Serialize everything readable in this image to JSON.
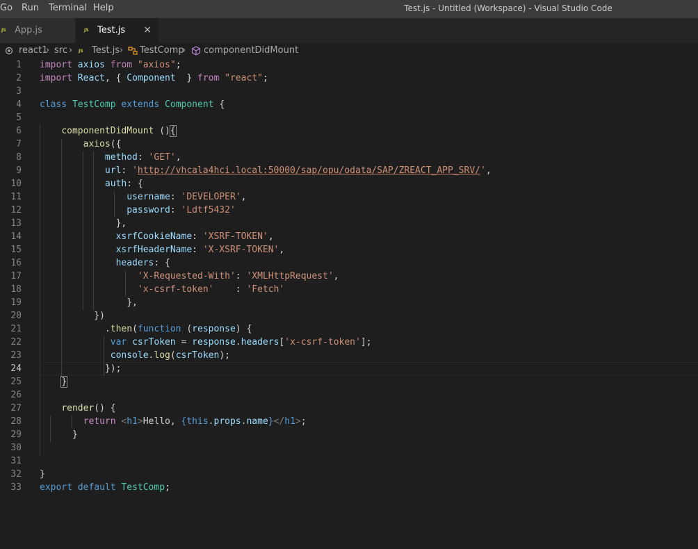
{
  "menu": [
    "Go",
    "Run",
    "Terminal",
    "Help"
  ],
  "window_title": "Test.js - Untitled (Workspace) - Visual Studio Code",
  "tabs": [
    {
      "label": "App.js",
      "icon": "JS",
      "active": false
    },
    {
      "label": "Test.js",
      "icon": "JS",
      "active": true,
      "close": "×"
    }
  ],
  "breadcrumb": {
    "root": "react1",
    "folder": "src",
    "file": "Test.js",
    "class": "TestComp",
    "method": "componentDidMount",
    "separator": "›"
  },
  "editor": {
    "current_line": 24,
    "line_numbers": [
      "1",
      "2",
      "3",
      "4",
      "5",
      "6",
      "7",
      "8",
      "9",
      "10",
      "11",
      "12",
      "13",
      "14",
      "15",
      "16",
      "17",
      "18",
      "19",
      "20",
      "21",
      "22",
      "23",
      "24",
      "25",
      "26",
      "27",
      "28",
      "29",
      "30",
      "31",
      "32",
      "33"
    ]
  },
  "code_lines": [
    "import axios from \"axios\";",
    "import React, { Component  } from \"react\";",
    "",
    "class TestComp extends Component {",
    "",
    "    componentDidMount (){",
    "        axios({",
    "            method: 'GET',",
    "            url: 'http://vhcala4hci.local:50000/sap/opu/odata/SAP/ZREACT_APP_SRV/',",
    "            auth: {",
    "                username: 'DEVELOPER',",
    "                password: 'Ldtf5432'",
    "              },",
    "              xsrfCookieName: 'XSRF-TOKEN',",
    "              xsrfHeaderName: 'X-XSRF-TOKEN',",
    "              headers: {",
    "                  'X-Requested-With': 'XMLHttpRequest',",
    "                  'x-csrf-token'    : 'Fetch'",
    "                },",
    "          })",
    "            .then(function (response) {",
    "             var csrToken = response.headers['x-csrf-token'];",
    "             console.log(csrToken);",
    "            });",
    "    }",
    "",
    "    render() {",
    "        return <h1>Hello, {this.props.name}</h1>;",
    "      }",
    "",
    "",
    "}",
    "export default TestComp;"
  ],
  "colors": {
    "editor_bg": "#1e1e1e",
    "titlebar_bg": "#3c3c3c",
    "tabbar_bg": "#252526",
    "keyword": "#c586c0",
    "storage": "#569cd6",
    "variable": "#9cdcfe",
    "string": "#ce9178",
    "type": "#4ec9b0",
    "function": "#dcdcaa"
  }
}
